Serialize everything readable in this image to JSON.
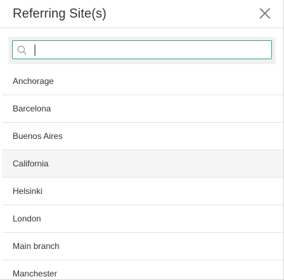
{
  "dialog": {
    "title": "Referring Site(s)",
    "close_icon": "close-icon"
  },
  "search": {
    "value": "",
    "placeholder": "",
    "icon": "search-icon",
    "border_color": "#3aa88f"
  },
  "sites": [
    {
      "label": "Anchorage"
    },
    {
      "label": "Barcelona"
    },
    {
      "label": "Buenos Aires"
    },
    {
      "label": "California"
    },
    {
      "label": "Helsinki"
    },
    {
      "label": "London"
    },
    {
      "label": "Main branch"
    },
    {
      "label": "Manchester"
    }
  ],
  "highlighted_index": 3
}
